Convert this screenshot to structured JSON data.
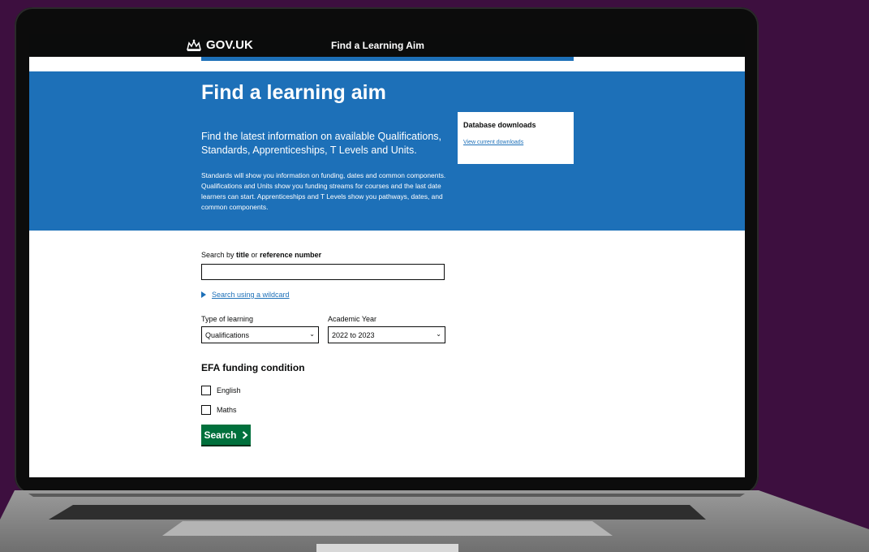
{
  "header": {
    "logo_text": "GOV.UK",
    "service_name": "Find a Learning Aim"
  },
  "hero": {
    "title": "Find a learning aim",
    "lead": "Find the latest information on available Qualifications, Standards, Apprenticeships, T Levels and Units.",
    "body": "Standards will show you information on funding, dates and common components. Qualifications and Units show you funding streams for courses and the last date learners can start. Apprenticeships and T Levels show you pathways, dates, and common components."
  },
  "downloads": {
    "title": "Database downloads",
    "link": "View current downloads"
  },
  "search": {
    "label_prefix": "Search by ",
    "label_title": "title",
    "label_or": " or ",
    "label_ref": "reference number",
    "value": "",
    "wildcard_link": "Search using a wildcard"
  },
  "filters": {
    "type_label": "Type of learning",
    "type_value": "Qualifications",
    "year_label": "Academic Year",
    "year_value": "2022 to 2023"
  },
  "efa": {
    "title": "EFA funding condition",
    "options": [
      "English",
      "Maths"
    ]
  },
  "button": {
    "search_label": "Search"
  },
  "colors": {
    "background": "#3d0f3f",
    "gov_blue": "#1d70b8",
    "header_black": "#0b0c0c",
    "button_green": "#00703c"
  },
  "icons": {
    "logo": "crown-icon",
    "button": "chevron-right-icon",
    "select": "chevron-down-icon",
    "details": "triangle-right-icon"
  }
}
